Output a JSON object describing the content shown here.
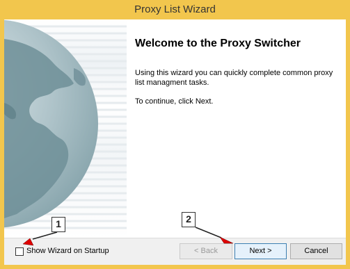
{
  "window": {
    "title": "Proxy List Wizard"
  },
  "content": {
    "heading": "Welcome to the Proxy Switcher",
    "description": "Using this wizard you can quickly complete common proxy list managment tasks.",
    "instruction": "To continue, click Next."
  },
  "footer": {
    "show_wizard_label": "Show Wizard on Startup",
    "show_wizard_checked": false,
    "back_label": "< Back",
    "next_label": "Next >",
    "cancel_label": "Cancel"
  },
  "annotations": {
    "marker1": "1",
    "marker2": "2"
  },
  "colors": {
    "titlebar": "#f2c64d",
    "annotation_arrow": "#e00000",
    "globe": "#7a9aa3"
  }
}
